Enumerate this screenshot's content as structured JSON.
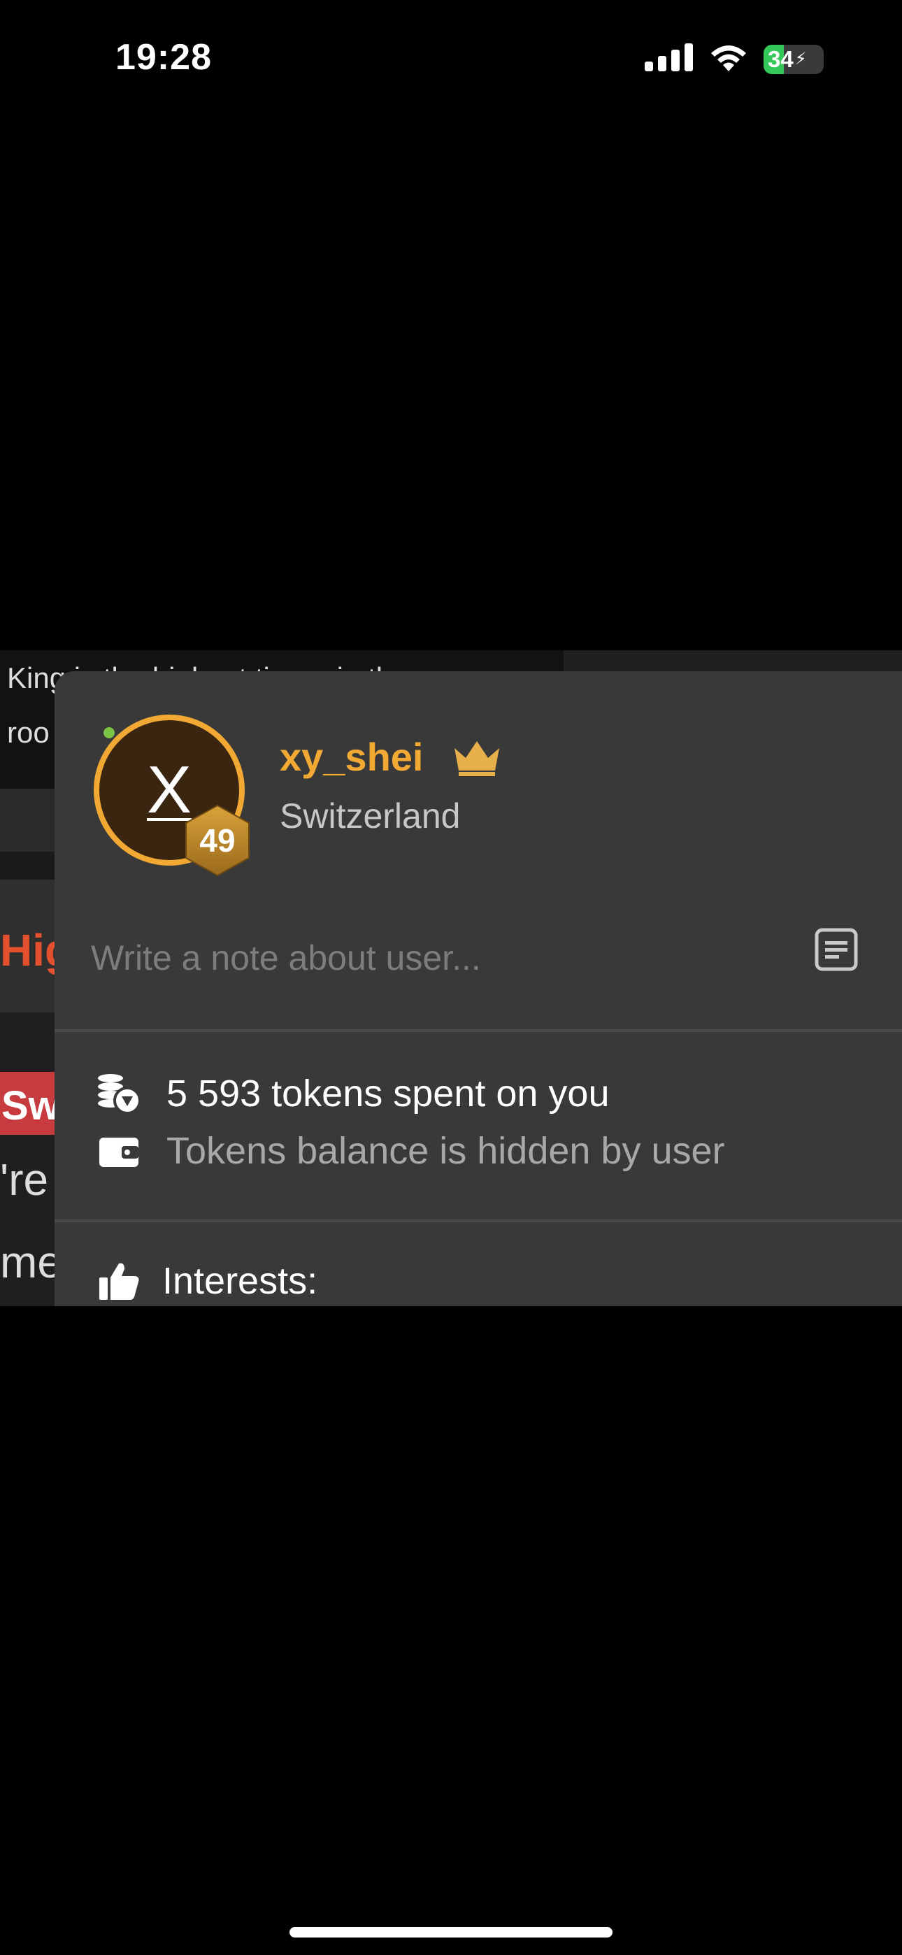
{
  "status_bar": {
    "time": "19:28",
    "battery": "34",
    "battery_level_percent": 34
  },
  "background_chat": {
    "line1": "King is the highest tipper in the",
    "line2": "roo",
    "fragment_hig": "Hig",
    "fragment_sw": "Sw",
    "fragment_re": "'re",
    "fragment_me": "me"
  },
  "profile": {
    "avatar_letter": "X",
    "level": "49",
    "username": "xy_shei",
    "country": "Switzerland",
    "note_placeholder": "Write a note about user...",
    "tokens_spent": "5 593 tokens spent on you",
    "balance_text": "Tokens balance is hidden by user",
    "interests_label": "Interests:"
  },
  "colors": {
    "accent": "#f1a933",
    "panel": "#393939",
    "online": "#7cc243"
  },
  "icons": [
    "signal-icon",
    "wifi-icon",
    "battery-icon",
    "crown-icon",
    "note-icon",
    "coins-icon",
    "wallet-icon",
    "thumbs-up-icon"
  ]
}
